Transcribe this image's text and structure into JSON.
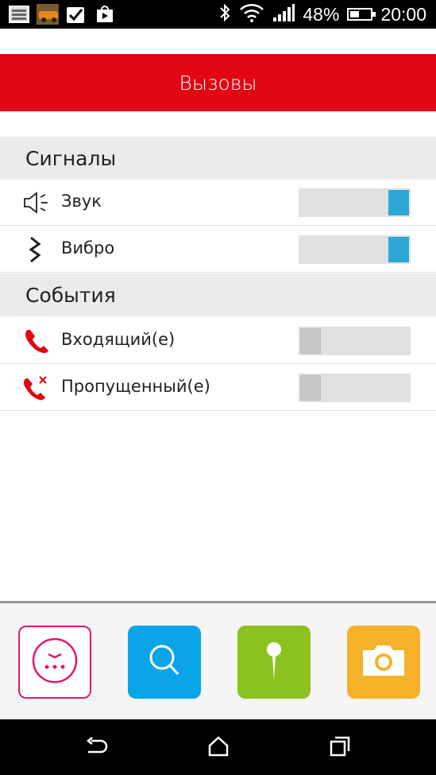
{
  "status_bar": {
    "battery_percent": "48%",
    "time": "20:00",
    "icons": [
      "gallery-notification-icon",
      "car-photo-notification-icon",
      "checkbox-notification-icon",
      "play-store-notification-icon",
      "bluetooth-icon",
      "wifi-icon",
      "signal-icon",
      "battery-icon"
    ]
  },
  "header": {
    "title": "Вызовы"
  },
  "sections": [
    {
      "title": "Сигналы",
      "items": [
        {
          "label": "Звук",
          "icon": "speaker-icon",
          "enabled": true
        },
        {
          "label": "Вибро",
          "icon": "vibrate-icon",
          "enabled": true
        }
      ]
    },
    {
      "title": "События",
      "items": [
        {
          "label": "Входящий(е)",
          "icon": "incoming-call-icon",
          "enabled": false
        },
        {
          "label": "Пропущенный(е)",
          "icon": "missed-call-icon",
          "enabled": false
        }
      ]
    }
  ],
  "dock": {
    "buttons": [
      {
        "name": "watch-button",
        "icon": "watch-icon",
        "color": "#e4176f"
      },
      {
        "name": "search-button",
        "icon": "search-icon",
        "color": "#0aa4e8"
      },
      {
        "name": "location-button",
        "icon": "pin-icon",
        "color": "#8cc21f"
      },
      {
        "name": "camera-button",
        "icon": "camera-icon",
        "color": "#f6b12a"
      }
    ]
  },
  "navbar": {
    "buttons": [
      "back-icon",
      "home-icon",
      "recents-icon"
    ]
  },
  "colors": {
    "accent_red": "#e10712",
    "toggle_on": "#2da8d6"
  }
}
